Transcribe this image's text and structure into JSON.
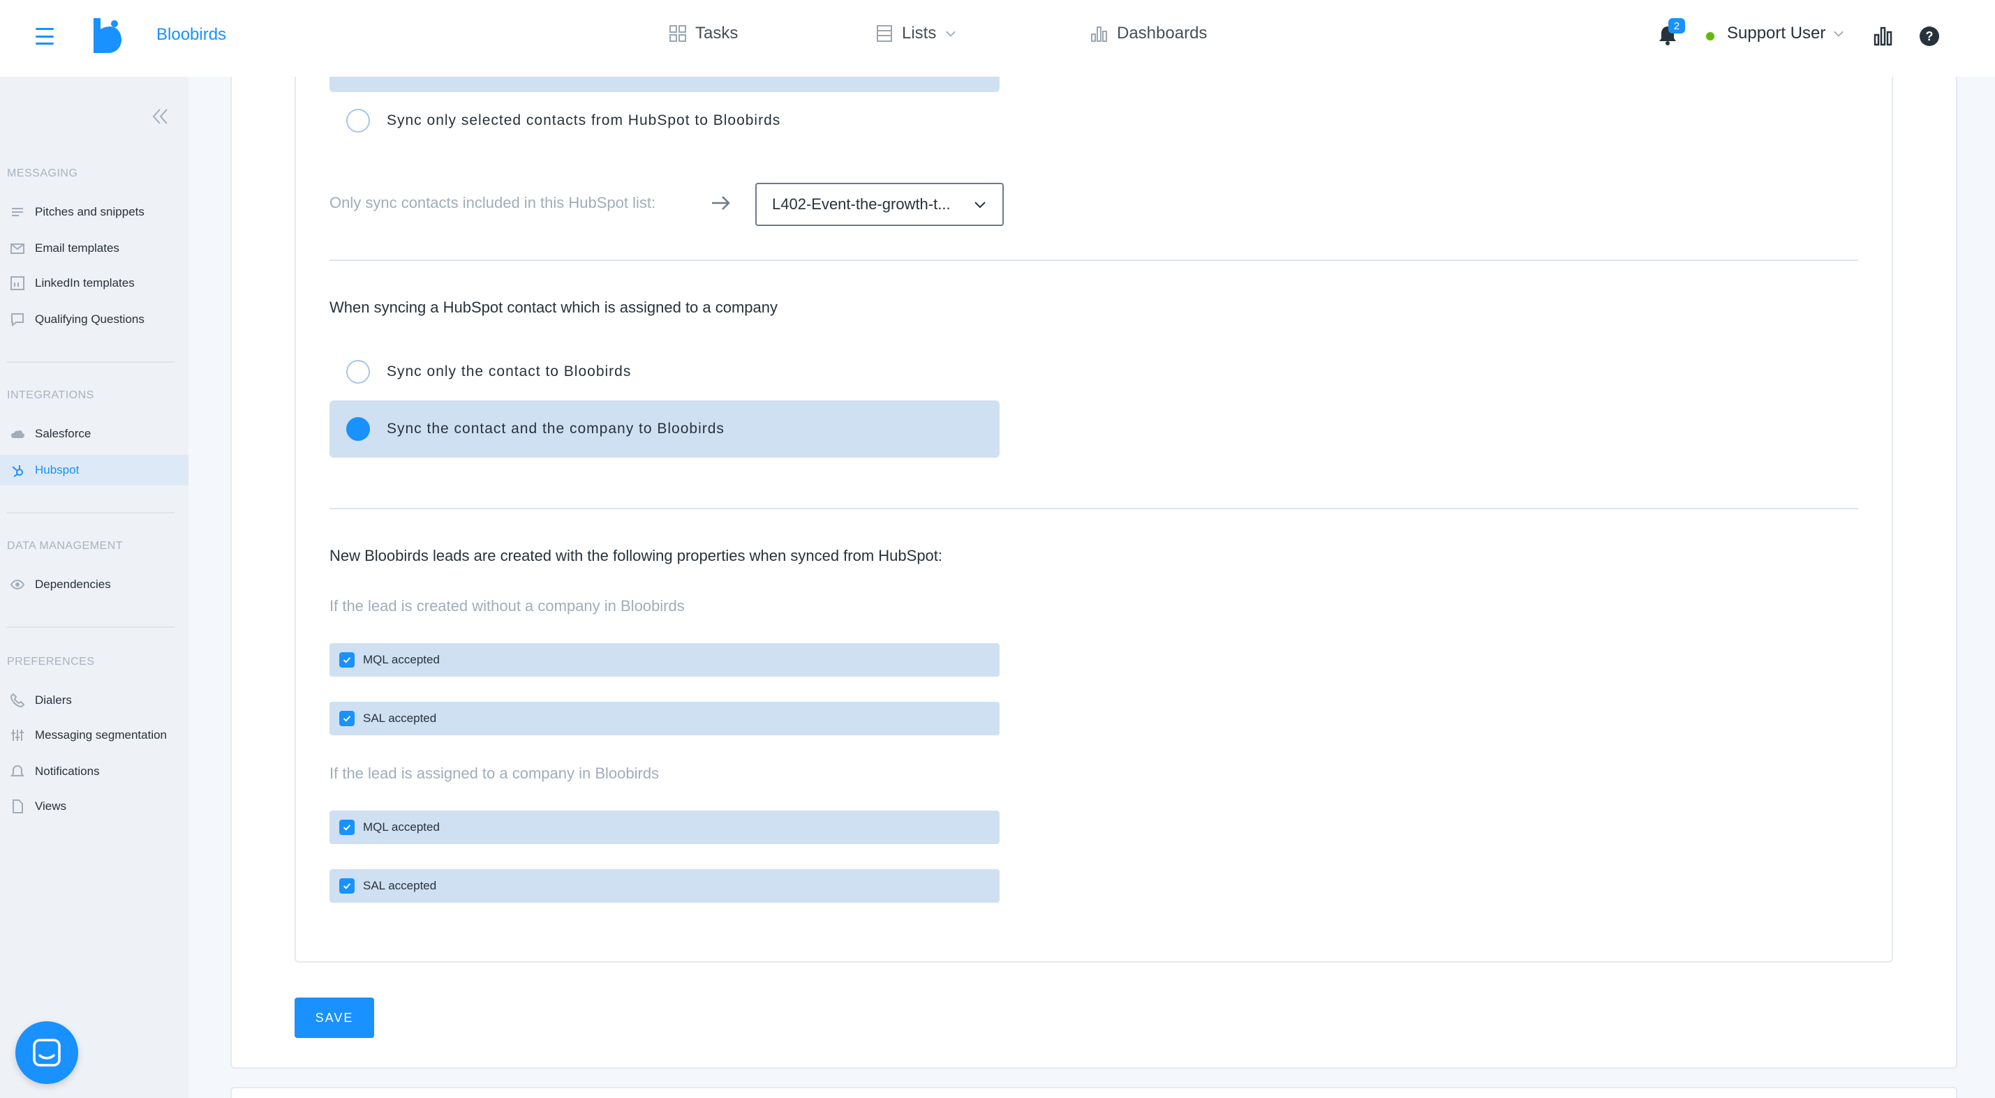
{
  "header": {
    "brand": "Bloobirds",
    "nav": [
      {
        "label": "Tasks"
      },
      {
        "label": "Lists"
      },
      {
        "label": "Dashboards"
      }
    ],
    "notifications_count": "2",
    "user_name": "Support User",
    "help_glyph": "?"
  },
  "sidebar": {
    "sections": [
      {
        "title": "MESSAGING",
        "items": [
          {
            "label": "Pitches and snippets",
            "icon": "list-icon"
          },
          {
            "label": "Email templates",
            "icon": "mail-icon"
          },
          {
            "label": "LinkedIn templates",
            "icon": "linkedin-icon"
          },
          {
            "label": "Qualifying Questions",
            "icon": "chat-icon"
          }
        ]
      },
      {
        "title": "INTEGRATIONS",
        "items": [
          {
            "label": "Salesforce",
            "icon": "cloud-icon"
          },
          {
            "label": "Hubspot",
            "icon": "hubspot-icon",
            "active": true
          }
        ]
      },
      {
        "title": "DATA MANAGEMENT",
        "items": [
          {
            "label": "Dependencies",
            "icon": "eye-icon"
          }
        ]
      },
      {
        "title": "PREFERENCES",
        "items": [
          {
            "label": "Dialers",
            "icon": "phone-icon"
          },
          {
            "label": "Messaging segmentation",
            "icon": "sliders-icon"
          },
          {
            "label": "Notifications",
            "icon": "bell-icon"
          },
          {
            "label": "Views",
            "icon": "file-icon"
          }
        ]
      }
    ]
  },
  "main": {
    "sync_selected_label": "Sync only selected contacts from HubSpot to Bloobirds",
    "list_filter_label": "Only sync contacts included in this HubSpot list:",
    "list_select_value": "L402-Event-the-growth-t...",
    "company_section_title": "When syncing a HubSpot contact which is assigned to a company",
    "company_options": [
      {
        "label": "Sync only the contact to Bloobirds",
        "selected": false
      },
      {
        "label": "Sync the contact and the company to Bloobirds",
        "selected": true
      }
    ],
    "properties_title": "New Bloobirds leads are created with the following properties when synced from HubSpot:",
    "without_company_label": "If the lead is created without a company in Bloobirds",
    "without_company_checks": [
      {
        "label": "MQL accepted",
        "checked": true
      },
      {
        "label": "SAL accepted",
        "checked": true
      }
    ],
    "with_company_label": "If the lead is assigned to a company in Bloobirds",
    "with_company_checks": [
      {
        "label": "MQL accepted",
        "checked": true
      },
      {
        "label": "SAL accepted",
        "checked": true
      }
    ],
    "save_label": "SAVE"
  },
  "colors": {
    "accent": "#1991ff",
    "selected_bg": "#cfe0f2",
    "status_online": "#63ba00"
  }
}
